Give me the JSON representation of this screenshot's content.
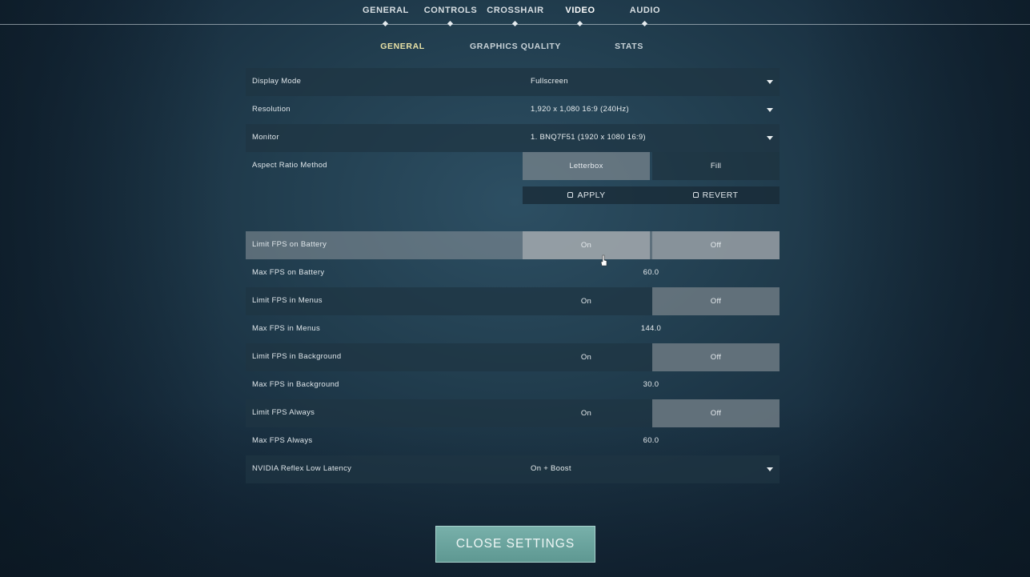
{
  "top_nav": {
    "tabs": [
      {
        "label": "GENERAL",
        "active": false
      },
      {
        "label": "CONTROLS",
        "active": false
      },
      {
        "label": "CROSSHAIR",
        "active": false
      },
      {
        "label": "VIDEO",
        "active": true
      },
      {
        "label": "AUDIO",
        "active": false
      }
    ]
  },
  "sub_nav": {
    "tabs": [
      {
        "label": "GENERAL",
        "active": true
      },
      {
        "label": "GRAPHICS QUALITY",
        "active": false
      },
      {
        "label": "STATS",
        "active": false
      }
    ]
  },
  "settings": {
    "display_mode": {
      "label": "Display Mode",
      "value": "Fullscreen"
    },
    "resolution": {
      "label": "Resolution",
      "value": "1,920 x 1,080 16:9 (240Hz)"
    },
    "monitor": {
      "label": "Monitor",
      "value": "1. BNQ7F51 (1920 x  1080 16:9)"
    },
    "aspect_ratio": {
      "label": "Aspect Ratio Method",
      "option_a": "Letterbox",
      "option_b": "Fill",
      "selected": "Letterbox"
    },
    "apply_label": "APPLY",
    "revert_label": "REVERT",
    "limit_fps_battery": {
      "label": "Limit FPS on Battery",
      "on": "On",
      "off": "Off",
      "selected": "On"
    },
    "max_fps_battery": {
      "label": "Max FPS on Battery",
      "value": "60.0"
    },
    "limit_fps_menus": {
      "label": "Limit FPS in Menus",
      "on": "On",
      "off": "Off",
      "selected": "Off"
    },
    "max_fps_menus": {
      "label": "Max FPS in Menus",
      "value": "144.0"
    },
    "limit_fps_background": {
      "label": "Limit FPS in Background",
      "on": "On",
      "off": "Off",
      "selected": "Off"
    },
    "max_fps_background": {
      "label": "Max FPS in Background",
      "value": "30.0"
    },
    "limit_fps_always": {
      "label": "Limit FPS Always",
      "on": "On",
      "off": "Off",
      "selected": "Off"
    },
    "max_fps_always": {
      "label": "Max FPS Always",
      "value": "60.0"
    },
    "nvidia_reflex": {
      "label": "NVIDIA Reflex Low Latency",
      "value": "On + Boost"
    }
  },
  "close_button": {
    "label": "CLOSE SETTINGS"
  },
  "colors": {
    "accent_active_subtab": "#e9e2a6",
    "close_button": "#6ea69f"
  }
}
